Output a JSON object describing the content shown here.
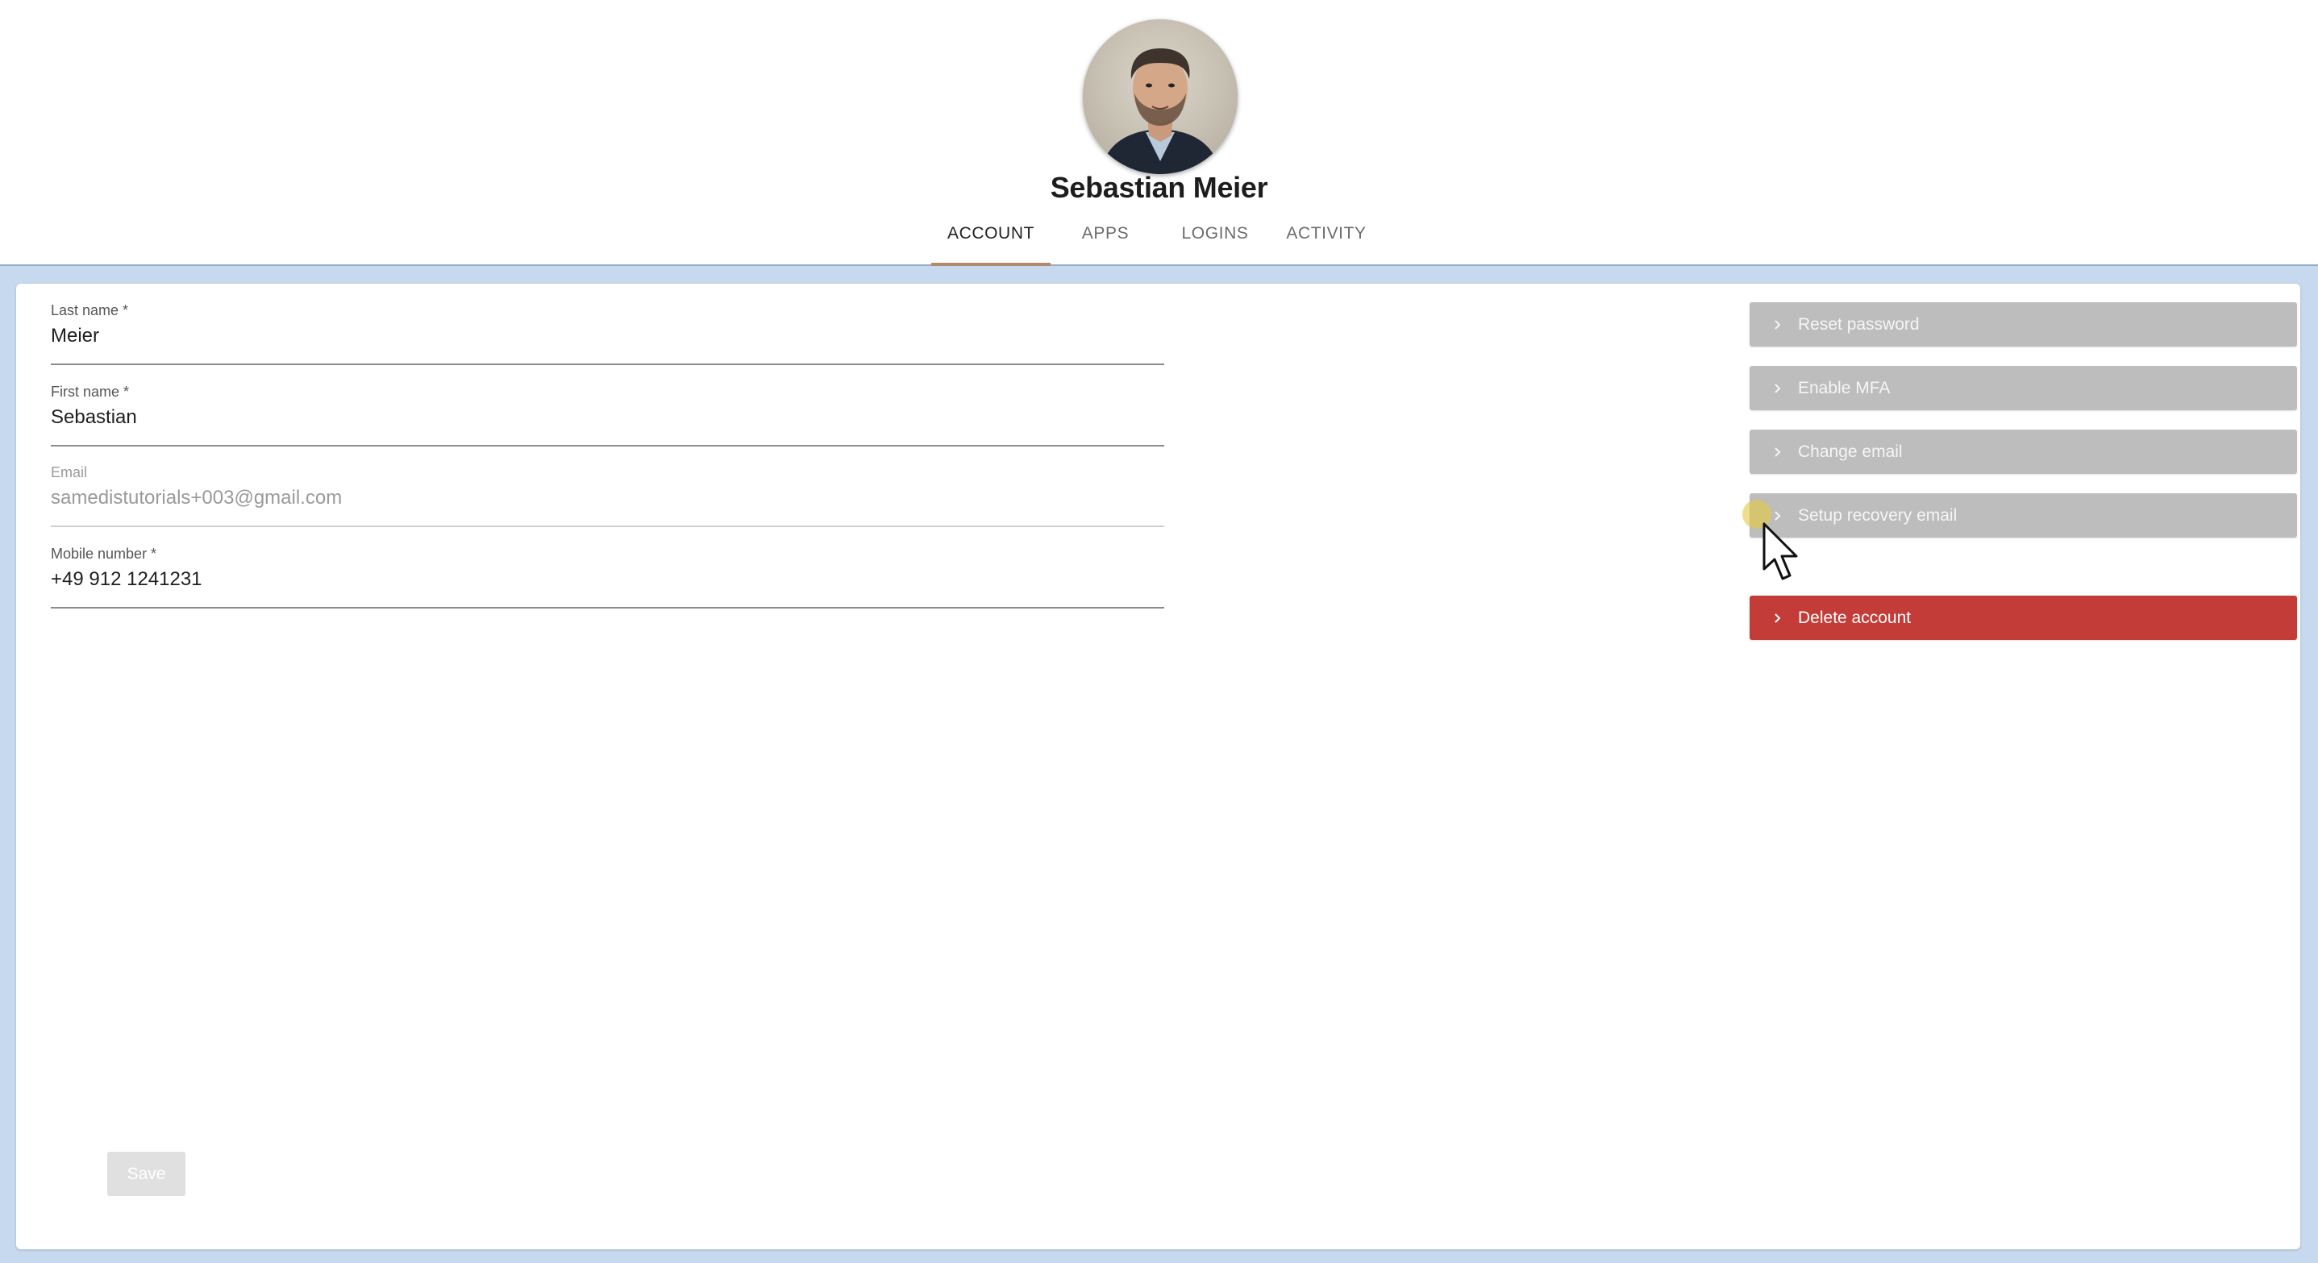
{
  "profile": {
    "name": "Sebastian Meier",
    "avatar_icon": "user-portrait"
  },
  "tabs": [
    {
      "label": "ACCOUNT",
      "active": true
    },
    {
      "label": "APPS",
      "active": false
    },
    {
      "label": "LOGINS",
      "active": false
    },
    {
      "label": "ACTIVITY",
      "active": false
    }
  ],
  "form": {
    "last_name": {
      "label": "Last name *",
      "value": "Meier"
    },
    "first_name": {
      "label": "First name *",
      "value": "Sebastian"
    },
    "email": {
      "label": "Email",
      "value": "samedistutorials+003@gmail.com",
      "disabled": true
    },
    "mobile": {
      "label": "Mobile number *",
      "value": "+49 912 1241231"
    },
    "save_label": "Save"
  },
  "actions": {
    "reset_password": "Reset password",
    "enable_mfa": "Enable MFA",
    "change_email": "Change email",
    "setup_recovery_email": "Setup recovery email",
    "delete_account": "Delete account"
  },
  "colors": {
    "tab_indicator": "#b08a6a",
    "backdrop": "#c6d9ef",
    "action_button": "#bdbdbd",
    "danger_button": "#c43c38"
  }
}
